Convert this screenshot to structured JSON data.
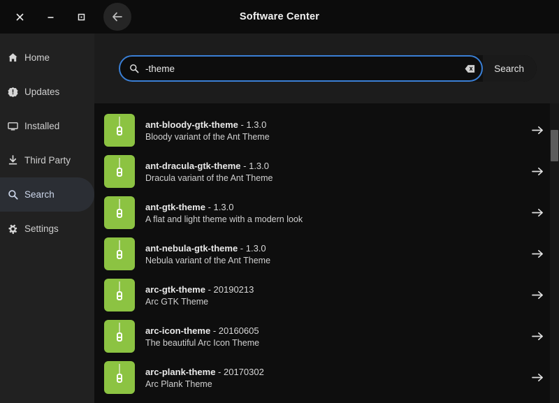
{
  "window": {
    "title": "Software Center",
    "controls": {
      "close_label": "close-window",
      "minimize_label": "minimize-window",
      "maximize_label": "maximize-window",
      "back_label": "back"
    }
  },
  "sidebar": {
    "items": [
      {
        "label": "Home",
        "icon": "home-icon",
        "selected": false
      },
      {
        "label": "Updates",
        "icon": "updates-icon",
        "selected": false
      },
      {
        "label": "Installed",
        "icon": "monitor-icon",
        "selected": false
      },
      {
        "label": "Third Party",
        "icon": "download-icon",
        "selected": false
      },
      {
        "label": "Search",
        "icon": "search-icon",
        "selected": true
      },
      {
        "label": "Settings",
        "icon": "gear-icon",
        "selected": false
      }
    ]
  },
  "search": {
    "value": "-theme",
    "placeholder": "",
    "icon": "search-icon",
    "clear_icon": "backspace-clear-icon",
    "button_label": "Search",
    "accent_color": "#3a7fd5"
  },
  "results": {
    "icon_color": "#8cc342",
    "arrow_icon": "arrow-right-icon",
    "items": [
      {
        "name": "ant-bloody-gtk-theme",
        "version": "1.3.0",
        "description": "Bloody variant of the Ant Theme"
      },
      {
        "name": "ant-dracula-gtk-theme",
        "version": "1.3.0",
        "description": "Dracula variant of the Ant Theme"
      },
      {
        "name": "ant-gtk-theme",
        "version": "1.3.0",
        "description": "A flat and light theme with a modern look"
      },
      {
        "name": "ant-nebula-gtk-theme",
        "version": "1.3.0",
        "description": "Nebula variant of the Ant Theme"
      },
      {
        "name": "arc-gtk-theme",
        "version": "20190213",
        "description": "Arc GTK Theme"
      },
      {
        "name": "arc-icon-theme",
        "version": "20160605",
        "description": "The beautiful Arc Icon Theme"
      },
      {
        "name": "arc-plank-theme",
        "version": "20170302",
        "description": "Arc Plank Theme"
      }
    ]
  },
  "scrollbar": {
    "thumb_color": "#5c5c5c"
  }
}
